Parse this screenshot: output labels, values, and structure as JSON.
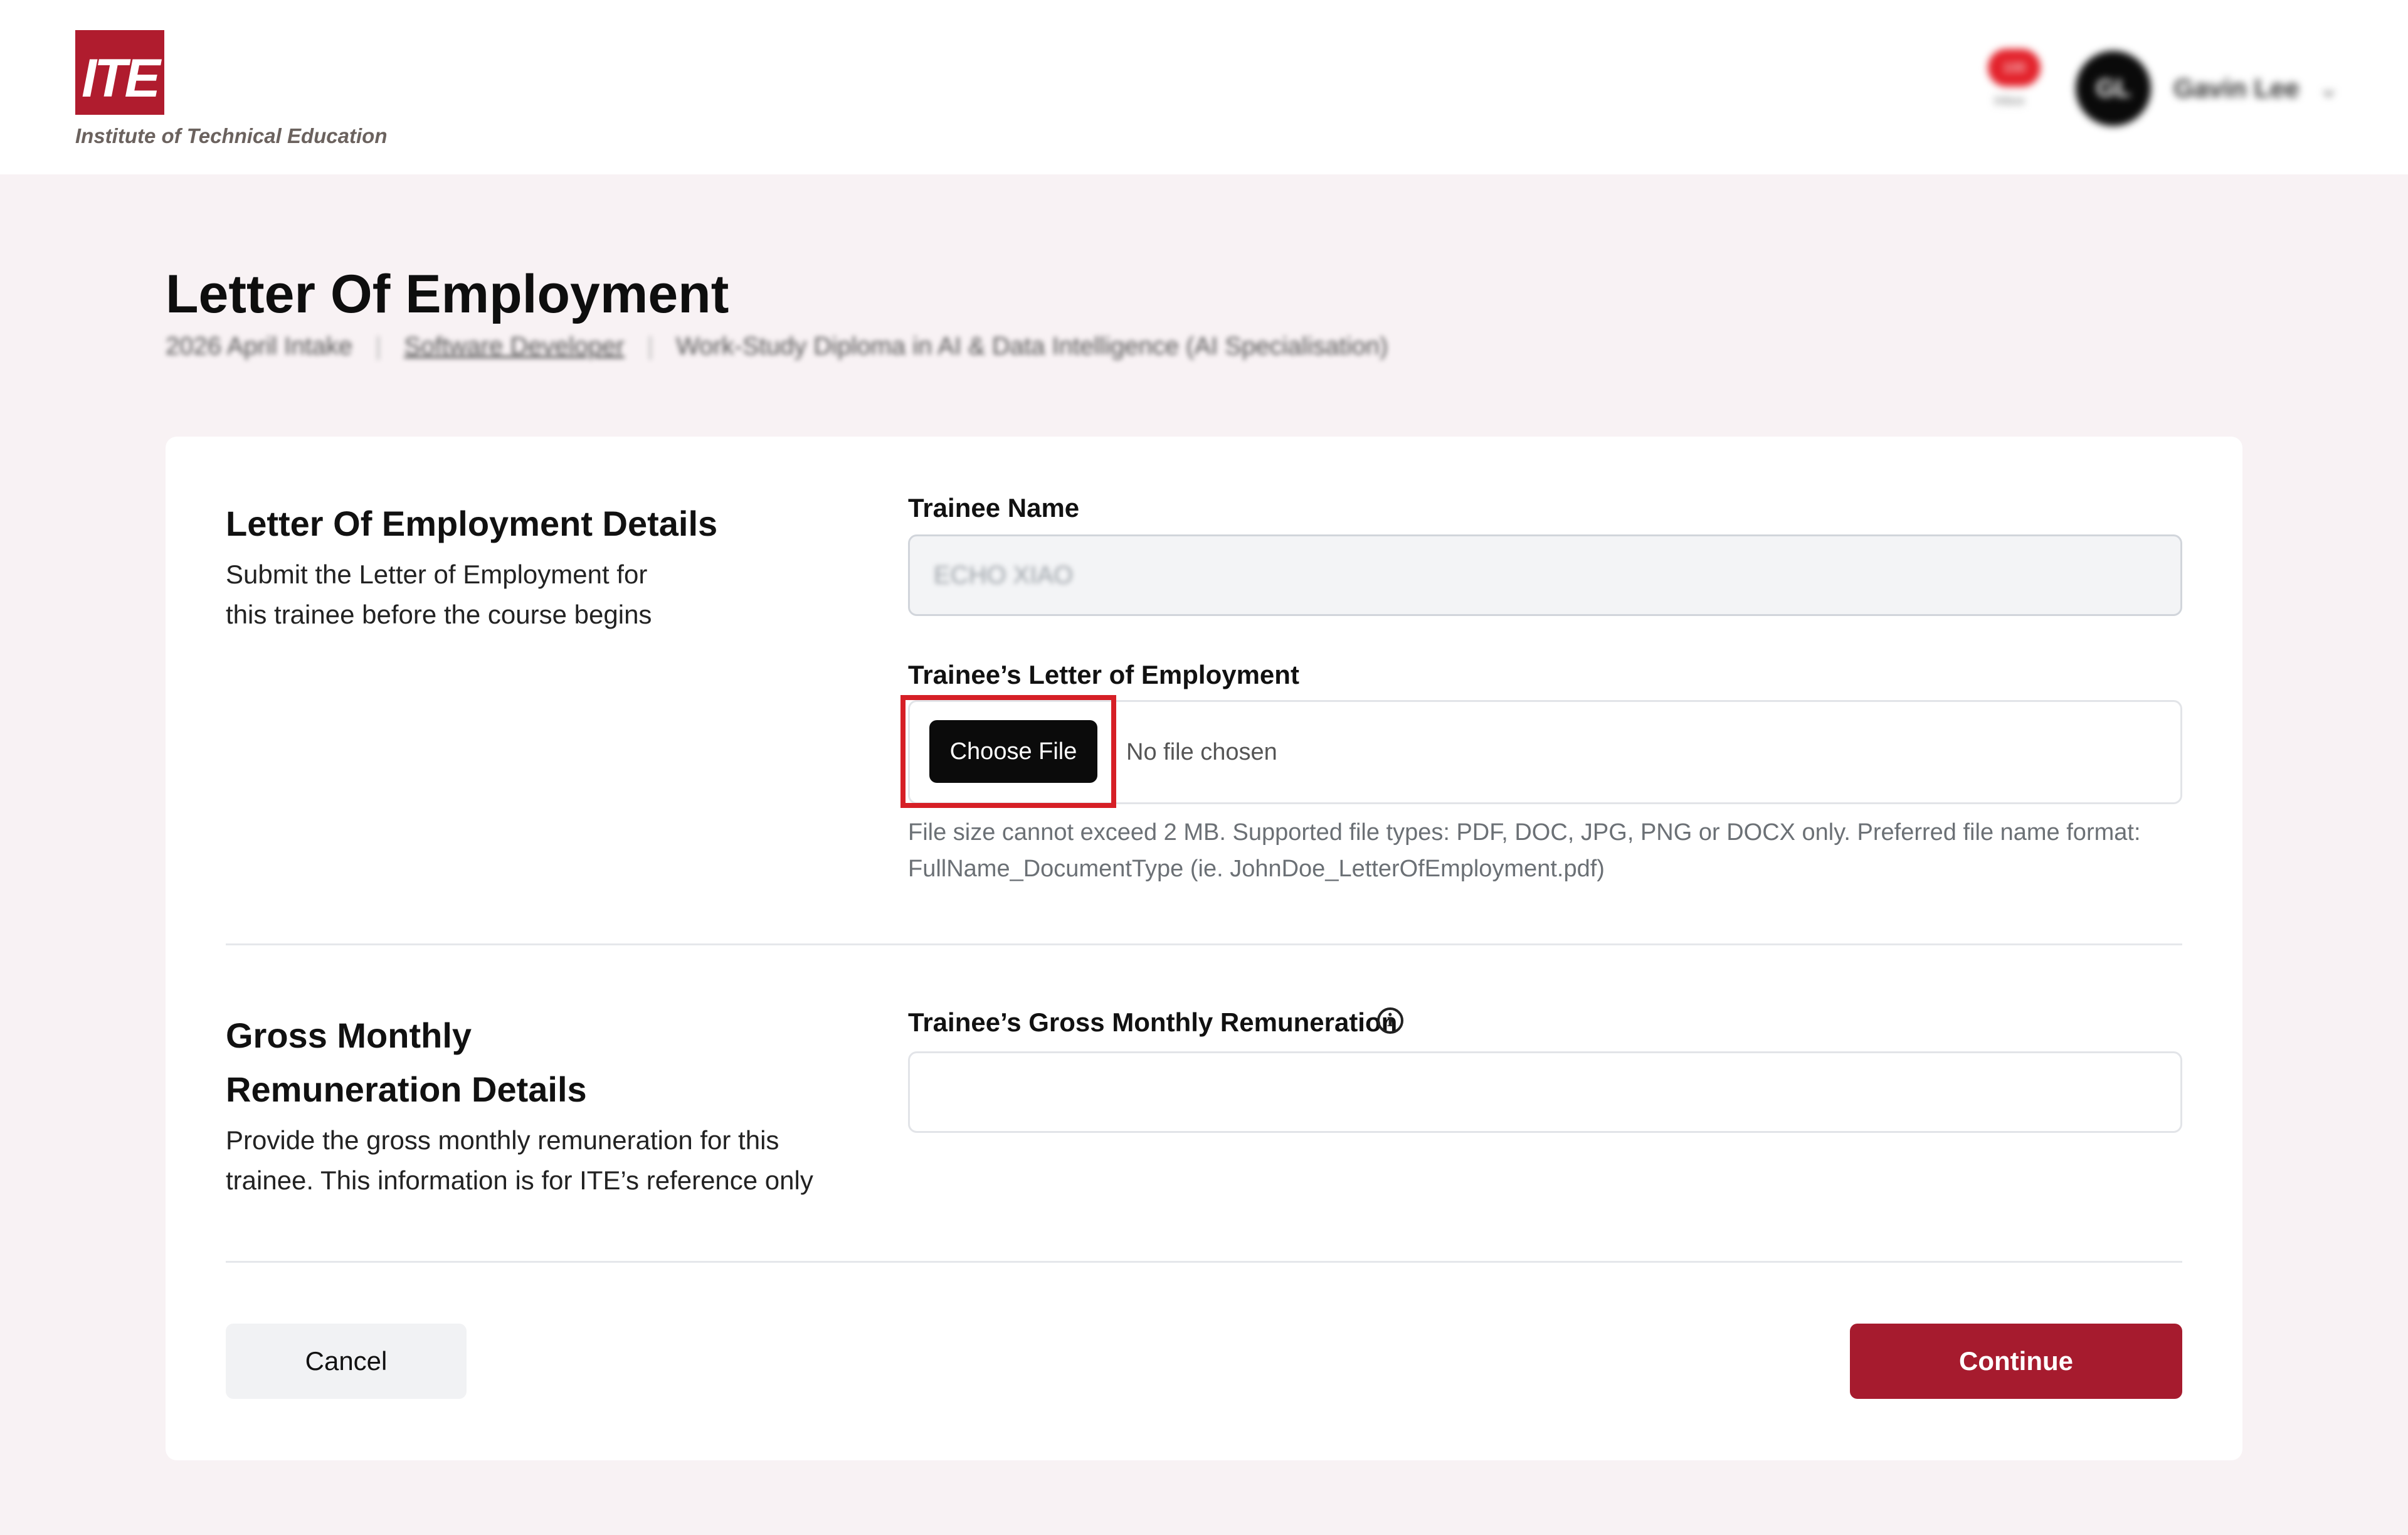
{
  "header": {
    "logo_text": "ITE",
    "org_name": "Institute of Technical Education",
    "notification_badge": "100",
    "notification_label": "Inbox",
    "user_initials": "GL",
    "user_name": "Gavin Lee"
  },
  "page": {
    "title": "Letter Of Employment",
    "breadcrumbs": [
      "2026 April Intake",
      "Software Developer",
      "Work-Study Diploma in AI & Data Intelligence (AI Specialisation)"
    ]
  },
  "loe_section": {
    "title": "Letter Of Employment Details",
    "description_line1": "Submit the Letter of Employment for",
    "description_line2": "this trainee before the course begins",
    "trainee_name_label": "Trainee Name",
    "trainee_name_value": "ECHO XIAO",
    "file_label": "Trainee’s Letter of Employment",
    "choose_file_label": "Choose File",
    "no_file_text": "No file chosen",
    "help_line1": "File size cannot exceed 2 MB. Supported file types: PDF, DOC, JPG, PNG or DOCX only. Preferred file name format:",
    "help_line2": "FullName_DocumentType (ie. JohnDoe_LetterOfEmployment.pdf)"
  },
  "remuneration_section": {
    "title_line1": "Gross Monthly",
    "title_line2": "Remuneration Details",
    "description_line1": "Provide the gross monthly remuneration for this",
    "description_line2": "trainee. This information is for ITE’s reference only",
    "field_label": "Trainee’s Gross Monthly Remuneration",
    "field_value": "",
    "info_icon": "info-icon"
  },
  "actions": {
    "cancel_label": "Cancel",
    "continue_label": "Continue"
  },
  "colors": {
    "brand_red": "#b01c2e",
    "continue_red": "#a61b2e",
    "highlight_red": "#d61f26",
    "page_background": "#f8f2f4"
  }
}
